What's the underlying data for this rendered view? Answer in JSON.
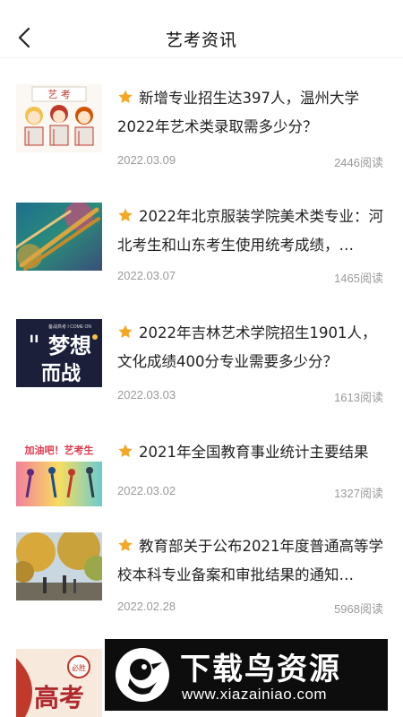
{
  "header": {
    "title": "艺考资讯"
  },
  "articles": [
    {
      "title": "新增专业招生达397人，温州大学2022年艺术类录取需多少分？",
      "date": "2022.03.09",
      "reads": "2446阅读",
      "thumb_text": "艺 考"
    },
    {
      "title": "2022年北京服装学院美术类专业：河北考生和山东考生使用统考成绩，…",
      "date": "2022.03.07",
      "reads": "1465阅读"
    },
    {
      "title": "2022年吉林艺术学院招生1901人，文化成绩400分专业需要多少分？",
      "date": "2022.03.03",
      "reads": "1613阅读",
      "thumb_text_top": "备战高考 I COME ON",
      "thumb_text_main": "梦想",
      "thumb_text_bottom": "而战"
    },
    {
      "title": "2021年全国教育事业统计主要结果",
      "date": "2022.03.02",
      "reads": "1327阅读",
      "thumb_text": "加油吧！艺考生"
    },
    {
      "title": "教育部关于公布2021年度普通高等学校本科专业备案和审批结果的通知…",
      "date": "2022.02.28",
      "reads": "5968阅读"
    },
    {
      "thumb_text": "高考",
      "thumb_badge": "必胜"
    }
  ],
  "watermark": {
    "title": "下载鸟资源",
    "url": "www.xiazainiao.com"
  },
  "colors": {
    "star": "#f5a623",
    "meta_text": "#9a9a9a"
  }
}
